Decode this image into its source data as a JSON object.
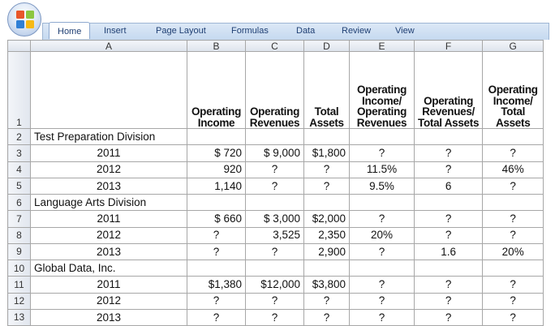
{
  "ribbon": {
    "tabs": [
      "Home",
      "Insert",
      "Page Layout",
      "Formulas",
      "Data",
      "Review",
      "View"
    ],
    "active_tab": "Home"
  },
  "sheet": {
    "columns": [
      "A",
      "B",
      "C",
      "D",
      "E",
      "F",
      "G"
    ],
    "row_numbers": [
      "1",
      "2",
      "3",
      "4",
      "5",
      "6",
      "7",
      "8",
      "9",
      "10",
      "11",
      "12",
      "13"
    ],
    "headers": {
      "b": [
        "Operating",
        "Income"
      ],
      "c": [
        "Operating",
        "Revenues"
      ],
      "d": [
        "Total",
        "Assets"
      ],
      "e": [
        "Operating",
        "Income/",
        "Operating",
        "Revenues"
      ],
      "f": [
        "Operating",
        "Revenues/",
        "Total Assets"
      ],
      "g": [
        "Operating",
        "Income/",
        "Total",
        "Assets"
      ]
    },
    "rows": [
      {
        "a": "Test Preparation Division",
        "section": true,
        "b": "",
        "c": "",
        "d": "",
        "e": "",
        "f": "",
        "g": ""
      },
      {
        "a": "2011",
        "b": "$  720",
        "c": "$ 9,000",
        "d": "$1,800",
        "e": "?",
        "f": "?",
        "g": "?"
      },
      {
        "a": "2012",
        "b": "920",
        "c": "?",
        "d": "?",
        "e": "11.5%",
        "f": "?",
        "g": "46%"
      },
      {
        "a": "2013",
        "b": "1,140",
        "c": "?",
        "d": "?",
        "e": "9.5%",
        "f": "6",
        "g": "?"
      },
      {
        "a": "Language Arts Division",
        "section": true,
        "b": "",
        "c": "",
        "d": "",
        "e": "",
        "f": "",
        "g": ""
      },
      {
        "a": "2011",
        "b": "$  660",
        "c": "$ 3,000",
        "d": "$2,000",
        "e": "?",
        "f": "?",
        "g": "?"
      },
      {
        "a": "2012",
        "b": "?",
        "c": "3,525",
        "d": "2,350",
        "e": "20%",
        "f": "?",
        "g": "?"
      },
      {
        "a": "2013",
        "b": "?",
        "c": "?",
        "d": "2,900",
        "e": "?",
        "f": "1.6",
        "g": "20%"
      },
      {
        "a": "Global Data, Inc.",
        "section": true,
        "b": "",
        "c": "",
        "d": "",
        "e": "",
        "f": "",
        "g": ""
      },
      {
        "a": "2011",
        "b": "$1,380",
        "c": "$12,000",
        "d": "$3,800",
        "e": "?",
        "f": "?",
        "g": "?"
      },
      {
        "a": "2012",
        "b": "?",
        "c": "?",
        "d": "?",
        "e": "?",
        "f": "?",
        "g": "?"
      },
      {
        "a": "2013",
        "b": "?",
        "c": "?",
        "d": "?",
        "e": "?",
        "f": "?",
        "g": "?"
      }
    ]
  }
}
